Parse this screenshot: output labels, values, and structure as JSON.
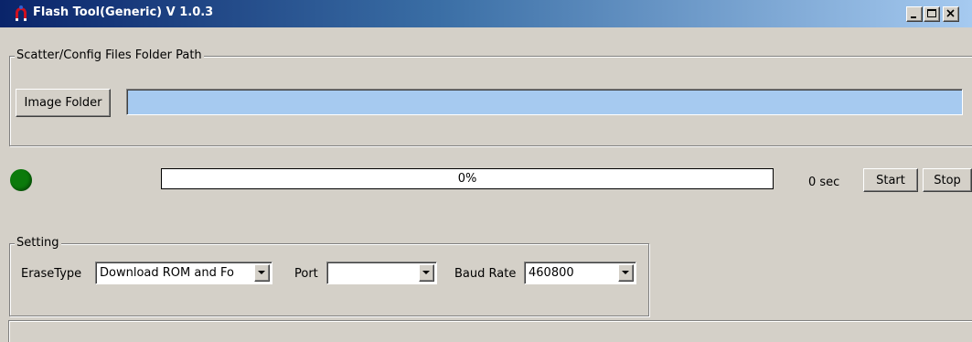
{
  "window": {
    "title": "Flash Tool(Generic) V 1.0.3",
    "icon": "flash-tool-app-icon",
    "controls": {
      "minimize_icon": "minimize-icon",
      "maximize_icon": "maximize-icon",
      "close_icon": "close-icon"
    }
  },
  "folder_group": {
    "label": "Scatter/Config Files Folder Path",
    "image_folder_button": "Image Folder",
    "path_value": ""
  },
  "progress": {
    "status_color": "#0b7a0b",
    "percent": 0,
    "percent_text": "0%",
    "elapsed_text": "0 sec",
    "start_button": "Start",
    "stop_button": "Stop"
  },
  "setting_group": {
    "label": "Setting",
    "erase_type": {
      "label": "EraseType",
      "value": "Download ROM and Fo"
    },
    "port": {
      "label": "Port",
      "value": ""
    },
    "baud_rate": {
      "label": "Baud Rate",
      "value": "460800"
    }
  },
  "status_bar": {
    "text": ""
  },
  "colors": {
    "window_bg": "#d4d0c8",
    "title_gradient_start": "#0a246a",
    "title_gradient_end": "#a6caf0",
    "path_field_bg": "#a6caf0"
  }
}
